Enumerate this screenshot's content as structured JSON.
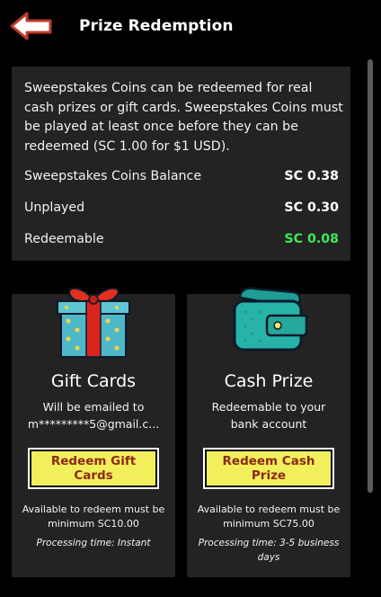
{
  "header": {
    "title": "Prize Redemption",
    "back_icon": "back-arrow-icon"
  },
  "info": {
    "description": "Sweepstakes Coins can be redeemed for real cash prizes or gift cards. Sweepstakes Coins must be played at least once before they can be redeemed (SC 1.00 for $1 USD).",
    "rows": [
      {
        "label": "Sweepstakes Coins Balance",
        "value": "SC 0.38"
      },
      {
        "label": "Unplayed",
        "value": "SC 0.30"
      },
      {
        "label": "Redeemable",
        "value": "SC 0.08"
      }
    ]
  },
  "cards": [
    {
      "icon": "gift-box-icon",
      "title": "Gift Cards",
      "desc_line1": "Will be emailed to",
      "desc_line2": "m*********5@gmail.c...",
      "button": "Redeem Gift Cards",
      "available": "Available to redeem must be minimum SC10.00",
      "processing": "Processing time: Instant"
    },
    {
      "icon": "wallet-icon",
      "title": "Cash Prize",
      "desc_line1": "Redeemable to your",
      "desc_line2": "bank account",
      "button": "Redeem Cash Prize",
      "available": "Available to redeem must be minimum SC75.00",
      "processing": "Processing time: 3-5 business days"
    }
  ],
  "colors": {
    "background": "#000000",
    "card": "#232323",
    "button": "#f2ef5c",
    "button_text": "#8a2a14",
    "redeemable_value": "#3ee858"
  }
}
